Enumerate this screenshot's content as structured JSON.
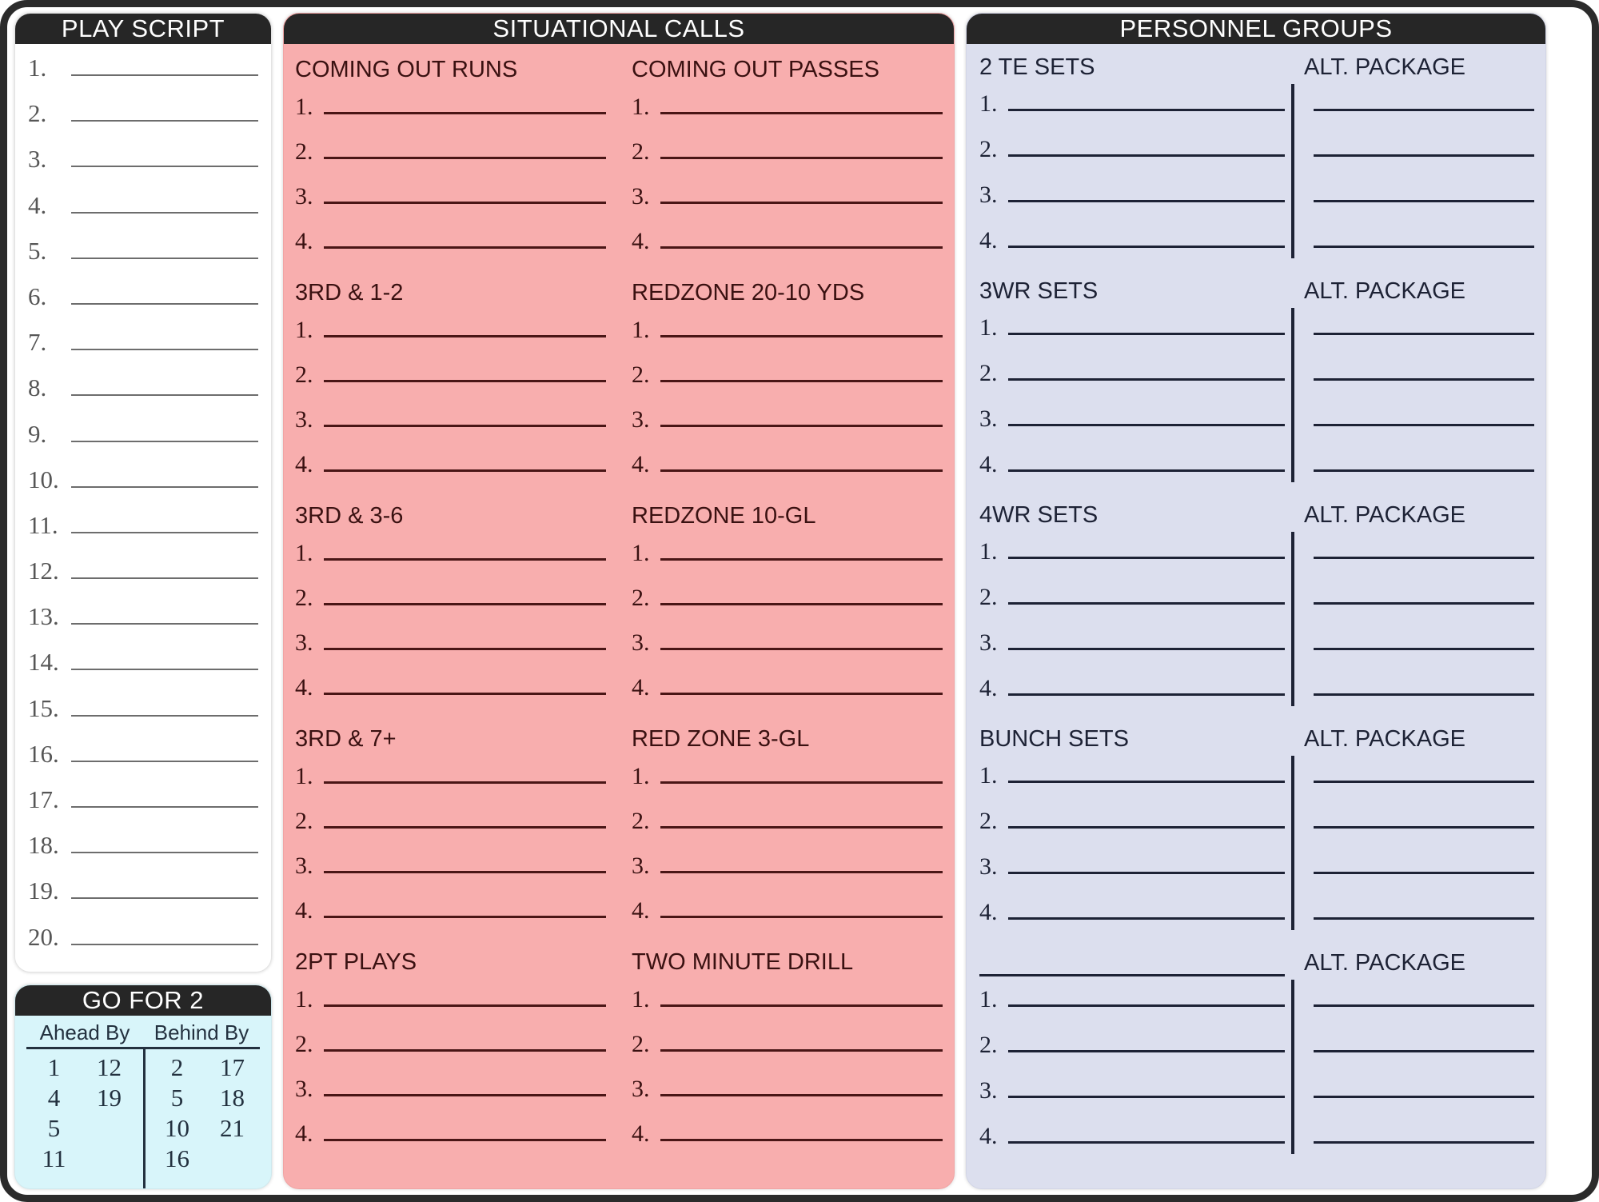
{
  "panels": {
    "play_script": {
      "title": "PLAY SCRIPT",
      "rows": [
        "1.",
        "2.",
        "3.",
        "4.",
        "5.",
        "6.",
        "7.",
        "8.",
        "9.",
        "10.",
        "11.",
        "12.",
        "13.",
        "14.",
        "15.",
        "16.",
        "17.",
        "18.",
        "19.",
        "20."
      ]
    },
    "go_for_2": {
      "title": "GO FOR 2",
      "headers": [
        "Ahead By",
        "Behind By"
      ],
      "ahead_by": {
        "col1": [
          "1",
          "4",
          "5",
          "11"
        ],
        "col2": [
          "12",
          "19",
          "",
          ""
        ]
      },
      "behind_by": {
        "col1": [
          "2",
          "5",
          "10",
          "16"
        ],
        "col2": [
          "17",
          "18",
          "21",
          ""
        ]
      }
    },
    "situational_calls": {
      "title": "SITUATIONAL CALLS",
      "left_blocks": [
        {
          "title": "COMING OUT RUNS",
          "rows": [
            "1.",
            "2.",
            "3.",
            "4."
          ]
        },
        {
          "title": "3RD & 1-2",
          "rows": [
            "1.",
            "2.",
            "3.",
            "4."
          ]
        },
        {
          "title": "3RD & 3-6",
          "rows": [
            "1.",
            "2.",
            "3.",
            "4."
          ]
        },
        {
          "title": "3RD & 7+",
          "rows": [
            "1.",
            "2.",
            "3.",
            "4."
          ]
        },
        {
          "title": "2PT PLAYS",
          "rows": [
            "1.",
            "2.",
            "3.",
            "4."
          ]
        }
      ],
      "right_blocks": [
        {
          "title": "COMING OUT PASSES",
          "rows": [
            "1.",
            "2.",
            "3.",
            "4."
          ]
        },
        {
          "title": "REDZONE 20-10 YDS",
          "rows": [
            "1.",
            "2.",
            "3.",
            "4."
          ]
        },
        {
          "title": "REDZONE 10-GL",
          "rows": [
            "1.",
            "2.",
            "3.",
            "4."
          ]
        },
        {
          "title": "RED ZONE 3-GL",
          "rows": [
            "1.",
            "2.",
            "3.",
            "4."
          ]
        },
        {
          "title": "TWO MINUTE DRILL",
          "rows": [
            "1.",
            "2.",
            "3.",
            "4."
          ]
        }
      ]
    },
    "personnel_groups": {
      "title": "PERSONNEL GROUPS",
      "blocks": [
        {
          "left_title": "2 TE SETS",
          "right_title": "ALT. PACKAGE",
          "left_title_blank": false,
          "rows": [
            "1.",
            "2.",
            "3.",
            "4."
          ]
        },
        {
          "left_title": "3WR SETS",
          "right_title": "ALT. PACKAGE",
          "left_title_blank": false,
          "rows": [
            "1.",
            "2.",
            "3.",
            "4."
          ]
        },
        {
          "left_title": "4WR SETS",
          "right_title": "ALT. PACKAGE",
          "left_title_blank": false,
          "rows": [
            "1.",
            "2.",
            "3.",
            "4."
          ]
        },
        {
          "left_title": "BUNCH SETS",
          "right_title": "ALT. PACKAGE",
          "left_title_blank": false,
          "rows": [
            "1.",
            "2.",
            "3.",
            "4."
          ]
        },
        {
          "left_title": "",
          "right_title": "ALT. PACKAGE",
          "left_title_blank": true,
          "rows": [
            "1.",
            "2.",
            "3.",
            "4."
          ]
        }
      ]
    }
  },
  "colors": {
    "header_bar": "#262626",
    "header_text": "#ffffff",
    "play_script_bg": "#ffffff",
    "go_for_2_bg": "#d8f5fa",
    "situational_bg": "#f8aeae",
    "personnel_bg": "#dcdfee",
    "situational_ink": "#4a1616",
    "personnel_ink": "#1d2235",
    "frame": "#2b2b2b"
  }
}
